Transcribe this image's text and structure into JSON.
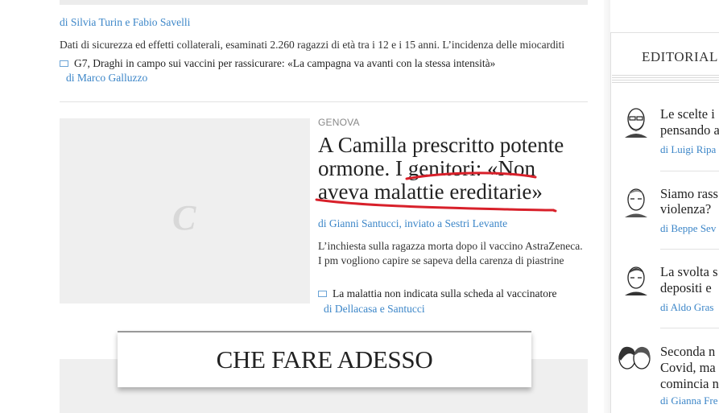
{
  "prev_article": {
    "byline": "di Silvia Turin e Fabio Savelli",
    "summary": "Dati di sicurezza ed effetti collaterali, esaminati 2.260 ragazzi di età tra i 12 e i 15 anni. L’incidenza delle miocarditi",
    "related": {
      "title": "G7, Draghi in campo sui vaccini per rassicurare: «La campagna va avanti con la stessa intensità»",
      "byline": "di Marco Galluzzo"
    }
  },
  "main_article": {
    "thumbnail_logo": "C",
    "kicker": "GENOVA",
    "headline": "A Camilla prescritto potente ormone. I genitori: «Non aveva malattie ereditarie»",
    "byline": "di Gianni Santucci, inviato a Sestri Levante",
    "summary": "L’inchiesta sulla ragazza morta dopo il vaccino AstraZeneca. I pm vogliono capire se sapeva della carenza di piastrine",
    "related": {
      "title": "La malattia non indicata sulla scheda al vaccinatore",
      "byline": "di Dellacasa e Santucci"
    },
    "annotation_color": "#d8202a"
  },
  "section_banner": {
    "title": "CHE FARE ADESSO"
  },
  "sidebar": {
    "title": "EDITORIAL",
    "items": [
      {
        "line1": "Le scelte i",
        "line2": "pensando a",
        "byline": "di Luigi Ripa"
      },
      {
        "line1": "Siamo rass",
        "line2": "violenza?",
        "byline": "di Beppe Sev"
      },
      {
        "line1": "La svolta s",
        "line2": "depositi e",
        "byline": "di Aldo Gras"
      },
      {
        "line1": "Seconda n",
        "line2": "Covid, ma",
        "line3": "comincia n",
        "byline": "di Gianna Fre"
      }
    ]
  },
  "colors": {
    "link": "#3c86c8",
    "text": "#222222",
    "placeholder": "#efefef"
  }
}
